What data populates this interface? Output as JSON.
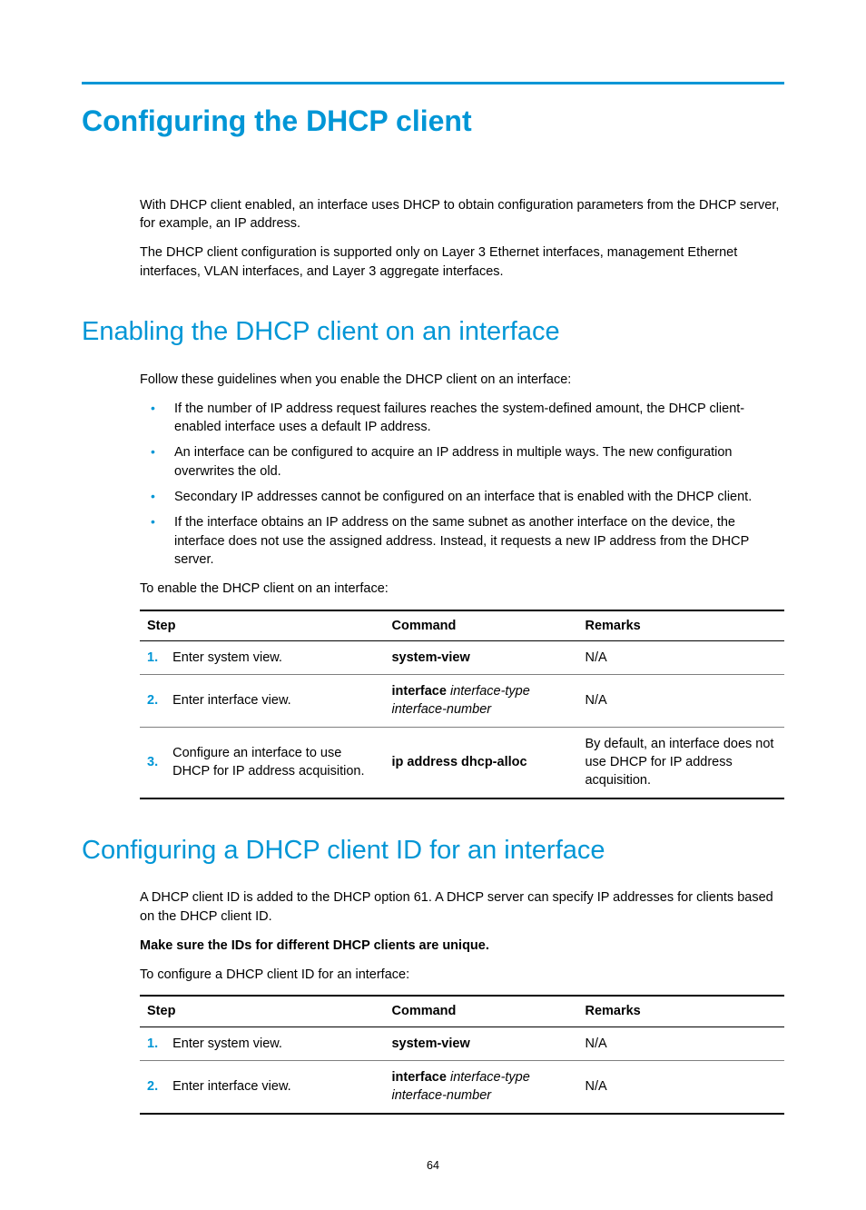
{
  "page_number": "64",
  "h1": "Configuring the DHCP client",
  "intro": {
    "p1": "With DHCP client enabled, an interface uses DHCP to obtain configuration parameters from the DHCP server, for example, an IP address.",
    "p2": "The DHCP client configuration is supported only on Layer 3 Ethernet interfaces, management Ethernet interfaces, VLAN interfaces, and Layer 3 aggregate interfaces."
  },
  "sec1": {
    "heading": "Enabling the DHCP client on an interface",
    "lead": "Follow these guidelines when you enable the DHCP client on an interface:",
    "bullets": [
      "If the number of IP address request failures reaches the system-defined amount, the DHCP client-enabled interface uses a default IP address.",
      "An interface can be configured to acquire an IP address in multiple ways. The new configuration overwrites the old.",
      "Secondary IP addresses cannot be configured on an interface that is enabled with the DHCP client.",
      "If the interface obtains an IP address on the same subnet as another interface on the device, the interface does not use the assigned address. Instead, it requests a new IP address from the DHCP server."
    ],
    "table_intro": "To enable the DHCP client on an interface:",
    "headers": {
      "step": "Step",
      "command": "Command",
      "remarks": "Remarks"
    },
    "rows": [
      {
        "n": "1.",
        "desc": "Enter system view.",
        "cmd_bold": "system-view",
        "cmd_ital": "",
        "remarks": "N/A"
      },
      {
        "n": "2.",
        "desc": "Enter interface view.",
        "cmd_bold": "interface",
        "cmd_ital": " interface-type interface-number",
        "remarks": "N/A"
      },
      {
        "n": "3.",
        "desc": "Configure an interface to use DHCP for IP address acquisition.",
        "cmd_bold": "ip address dhcp-alloc",
        "cmd_ital": "",
        "remarks": "By default, an interface does not use DHCP for IP address acquisition."
      }
    ]
  },
  "sec2": {
    "heading": "Configuring a DHCP client ID for an interface",
    "p1": "A DHCP client ID is added to the DHCP option 61. A DHCP server can specify IP addresses for clients based on the DHCP client ID.",
    "warn": "Make sure the IDs for different DHCP clients are unique.",
    "table_intro": "To configure a DHCP client ID for an interface:",
    "headers": {
      "step": "Step",
      "command": "Command",
      "remarks": "Remarks"
    },
    "rows": [
      {
        "n": "1.",
        "desc": "Enter system view.",
        "cmd_bold": "system-view",
        "cmd_ital": "",
        "remarks": "N/A"
      },
      {
        "n": "2.",
        "desc": "Enter interface view.",
        "cmd_bold": "interface",
        "cmd_ital": " interface-type interface-number",
        "remarks": "N/A"
      }
    ]
  }
}
